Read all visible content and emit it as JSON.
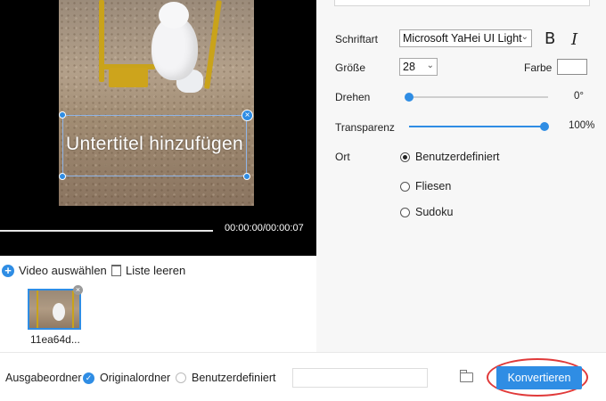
{
  "preview": {
    "subtitle_placeholder": "Untertitel hinzufügen",
    "close_glyph": "×",
    "time": "00:00:00/00:00:07"
  },
  "filelist": {
    "add_label": "Video auswählen",
    "clear_label": "Liste leeren",
    "plus_glyph": "+",
    "thumb_close_glyph": "×",
    "items": [
      {
        "name": "11ea64d..."
      }
    ]
  },
  "settings": {
    "font": {
      "label": "Schriftart",
      "value": "Microsoft YaHei UI Light"
    },
    "bold_label": "B",
    "italic_label": "I",
    "size": {
      "label": "Größe",
      "value": "28"
    },
    "color": {
      "label": "Farbe",
      "value": "#ffffff"
    },
    "rotate": {
      "label": "Drehen",
      "value_text": "0°",
      "fraction": 0.0
    },
    "transparency": {
      "label": "Transparenz",
      "value_text": "100%",
      "fraction": 1.0
    },
    "position": {
      "label": "Ort",
      "options": [
        {
          "label": "Benutzerdefiniert",
          "selected": true
        },
        {
          "label": "Fliesen",
          "selected": false
        },
        {
          "label": "Sudoku",
          "selected": false
        }
      ]
    }
  },
  "bottom": {
    "output_label": "Ausgabeordner",
    "original_label": "Originalordner",
    "custom_label": "Benutzerdefiniert",
    "original_selected": true,
    "check_glyph": "✓",
    "convert_label": "Konvertieren"
  },
  "colors": {
    "accent": "#2f8de4",
    "highlight_ring": "#e03a3a"
  },
  "chevron_glyph": "⌄"
}
